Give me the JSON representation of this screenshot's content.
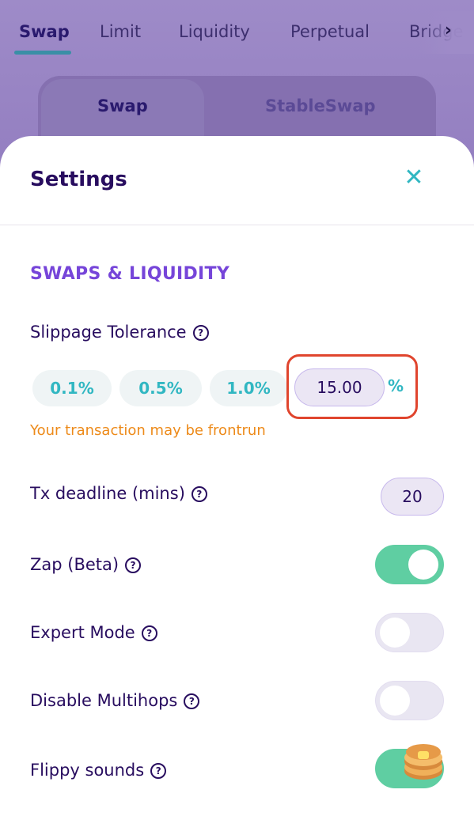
{
  "nav": {
    "tabs": [
      "Swap",
      "Limit",
      "Liquidity",
      "Perpetual",
      "Bridge"
    ],
    "active_tab": "Swap"
  },
  "swap_mode": {
    "tabs": [
      "Swap",
      "StableSwap"
    ],
    "active": "Swap"
  },
  "settings": {
    "title": "Settings",
    "section_title": "SWAPS & LIQUIDITY",
    "slippage": {
      "label": "Slippage Tolerance",
      "presets": [
        "0.1%",
        "0.5%",
        "1.0%"
      ],
      "value": "15.00",
      "unit": "%",
      "warning": "Your transaction may be frontrun"
    },
    "tx_deadline": {
      "label": "Tx deadline (mins)",
      "value": "20"
    },
    "toggles": [
      {
        "label": "Zap (Beta)",
        "on": true
      },
      {
        "label": "Expert Mode",
        "on": false
      },
      {
        "label": "Disable Multihops",
        "on": false
      },
      {
        "label": "Flippy sounds",
        "on": true
      }
    ]
  },
  "colors": {
    "primary_text": "#280d5f",
    "section": "#7645d9",
    "accent": "#31b7c2",
    "warning": "#ed8a19",
    "toggle_on": "#5fcea2",
    "highlight_box": "#e0452e"
  }
}
